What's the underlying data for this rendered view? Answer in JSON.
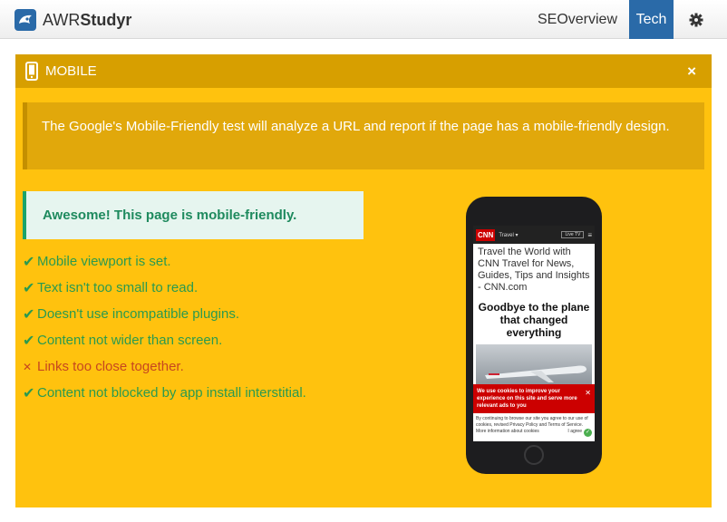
{
  "header": {
    "brand_light": "AWR",
    "brand_bold": "Studyr",
    "nav": {
      "seo_label": "SEOverview",
      "tech_label": "Tech"
    },
    "accent": "#2a6aa8"
  },
  "panel": {
    "title": "MOBILE",
    "close_label": "×",
    "description": "The Google's Mobile-Friendly test will analyze a URL and report if the page has a mobile-friendly design.",
    "success_message": "Awesome! This page is mobile-friendly.",
    "background": "#ffc20e",
    "checks": [
      {
        "mark": "✔",
        "text": "Mobile viewport is set.",
        "status": "pass"
      },
      {
        "mark": "✔",
        "text": "Text isn't too small to read.",
        "status": "pass"
      },
      {
        "mark": "✔",
        "text": "Doesn't use incompatible plugins.",
        "status": "pass"
      },
      {
        "mark": "✔",
        "text": "Content not wider than screen.",
        "status": "pass"
      },
      {
        "mark": "✕",
        "text": "Links too close together.",
        "status": "fail"
      },
      {
        "mark": "✔",
        "text": "Content not blocked by app install interstitial.",
        "status": "pass"
      }
    ]
  },
  "preview": {
    "logo": "CNN",
    "section": "Travel ▾",
    "live": "Live TV",
    "page_title": "Travel the World with CNN Travel for News, Guides, Tips and Insights - CNN.com",
    "headline": "Goodbye to the plane that changed everything",
    "cookie_banner": "We use cookies to improve your experience on this site and serve more relevant ads to you",
    "cookie_close": "✕",
    "cookie_footer": "By continuing to browse our site you agree to our use of cookies, revised Privacy Policy and Terms of Service. More information about cookies",
    "agree": "I agree"
  }
}
